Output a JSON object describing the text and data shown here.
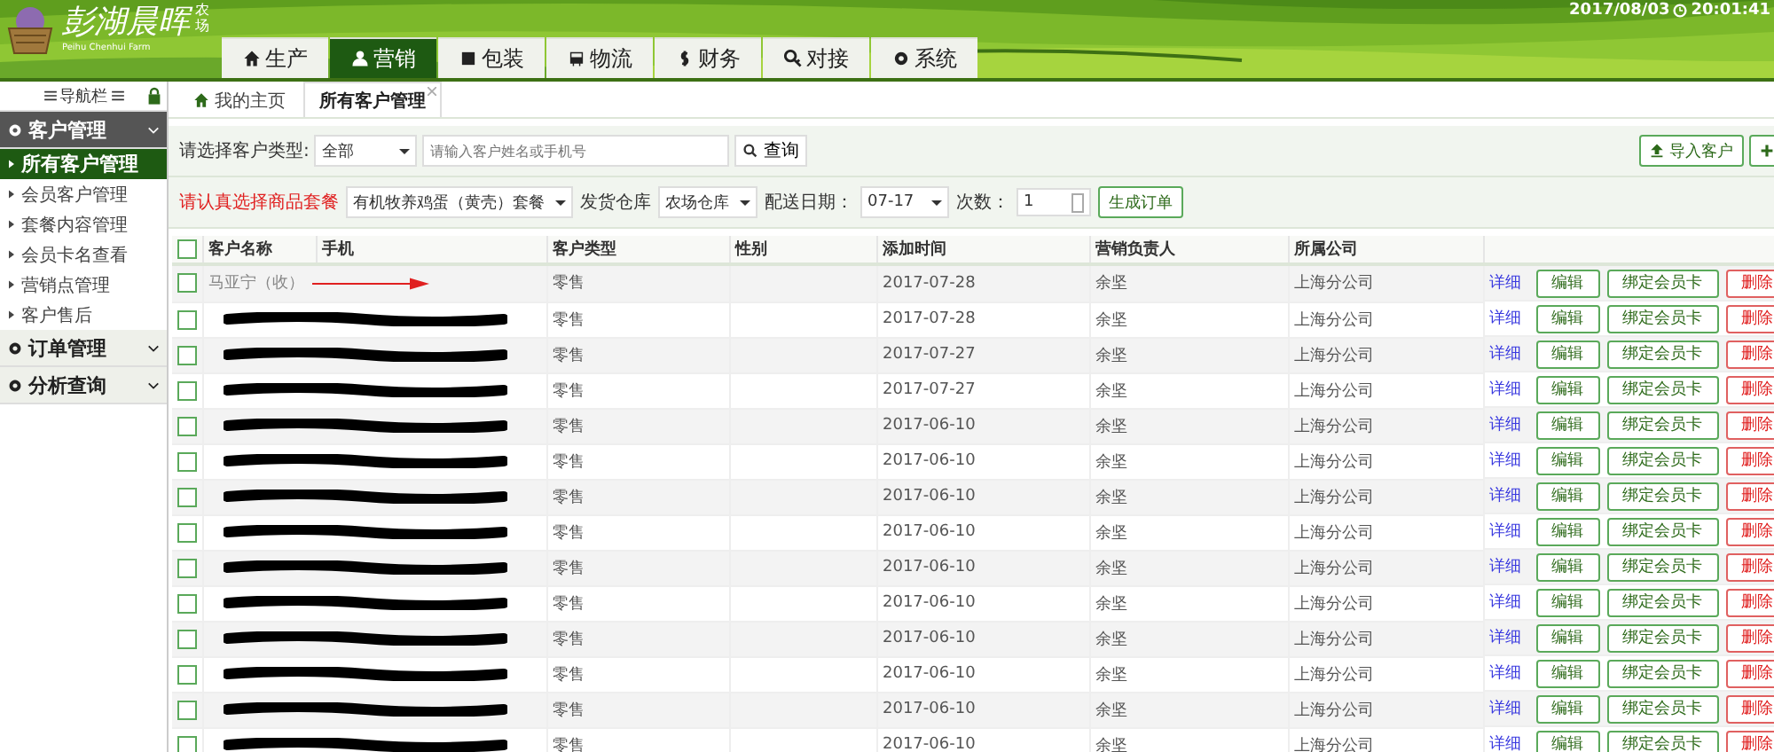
{
  "header": {
    "logo_text": "彭湖晨晖",
    "logo_side": "农场",
    "logo_sub": "Peihu Chenhui Farm",
    "datetime": "2017/08/03",
    "time": "20:01:41"
  },
  "nav_tabs": [
    {
      "label": "生产",
      "selected": false
    },
    {
      "label": "营销",
      "selected": true
    },
    {
      "label": "包装",
      "selected": false
    },
    {
      "label": "物流",
      "selected": false
    },
    {
      "label": "财务",
      "selected": false
    },
    {
      "label": "对接",
      "selected": false
    },
    {
      "label": "系统",
      "selected": false
    }
  ],
  "sidebar": {
    "title": "导航栏",
    "groups": [
      {
        "label": "客户管理",
        "expanded": true,
        "items": [
          {
            "label": "所有客户管理",
            "selected": true
          },
          {
            "label": "会员客户管理",
            "selected": false
          },
          {
            "label": "套餐内容管理",
            "selected": false
          },
          {
            "label": "会员卡名查看",
            "selected": false
          },
          {
            "label": "营销点管理",
            "selected": false
          },
          {
            "label": "客户售后",
            "selected": false
          }
        ]
      },
      {
        "label": "订单管理",
        "expanded": false
      },
      {
        "label": "分析查询",
        "expanded": false
      }
    ]
  },
  "page_tabs": [
    {
      "label": "我的主页",
      "selected": false
    },
    {
      "label": "所有客户管理",
      "selected": true
    }
  ],
  "filter": {
    "type_label": "请选择客户类型:",
    "type_value": "全部",
    "search_placeholder": "请输入客户姓名或手机号",
    "search_button": "查询",
    "import_button": "导入客户"
  },
  "order_bar": {
    "package_label": "请认真选择商品套餐",
    "package_value": "有机牧养鸡蛋（黄壳）套餐",
    "warehouse_label": "发货仓库",
    "warehouse_value": "农场仓库",
    "date_label": "配送日期：",
    "date_value": "07-17",
    "count_label": "次数：",
    "count_value": "1",
    "generate_button": "生成订单"
  },
  "table": {
    "all_checked": false,
    "columns": [
      "客户名称",
      "手机",
      "客户类型",
      "性别",
      "添加时间",
      "营销负责人",
      "所属公司"
    ],
    "rows": [
      {
        "kind": "arrow",
        "name": "马亚宁（收）",
        "type": "零售",
        "added": "2017-07-28",
        "manager": "余坚",
        "company": "上海分公司",
        "checked": false,
        "actions": [
          "详细",
          "编辑",
          "绑定会员卡",
          "删除"
        ]
      },
      {
        "kind": "redacted",
        "type": "零售",
        "added": "2017-07-28",
        "manager": "余坚",
        "company": "上海分公司",
        "checked": false,
        "actions": [
          "详细",
          "编辑",
          "绑定会员卡",
          "删除"
        ]
      },
      {
        "kind": "redacted",
        "type": "零售",
        "added": "2017-07-27",
        "manager": "余坚",
        "company": "上海分公司",
        "checked": false,
        "actions": [
          "详细",
          "编辑",
          "绑定会员卡",
          "删除"
        ]
      },
      {
        "kind": "redacted",
        "type": "零售",
        "added": "2017-07-27",
        "manager": "余坚",
        "company": "上海分公司",
        "checked": false,
        "actions": [
          "详细",
          "编辑",
          "绑定会员卡",
          "删除"
        ]
      },
      {
        "kind": "redacted",
        "type": "零售",
        "added": "2017-06-10",
        "manager": "余坚",
        "company": "上海分公司",
        "checked": false,
        "actions": [
          "详细",
          "编辑",
          "绑定会员卡",
          "删除"
        ]
      },
      {
        "kind": "redacted",
        "type": "零售",
        "added": "2017-06-10",
        "manager": "余坚",
        "company": "上海分公司",
        "checked": false,
        "actions": [
          "详细",
          "编辑",
          "绑定会员卡",
          "删除"
        ]
      },
      {
        "kind": "redacted",
        "type": "零售",
        "added": "2017-06-10",
        "manager": "余坚",
        "company": "上海分公司",
        "checked": false,
        "actions": [
          "详细",
          "编辑",
          "绑定会员卡",
          "删除"
        ]
      },
      {
        "kind": "redacted",
        "type": "零售",
        "added": "2017-06-10",
        "manager": "余坚",
        "company": "上海分公司",
        "checked": false,
        "actions": [
          "详细",
          "编辑",
          "绑定会员卡",
          "删除"
        ]
      },
      {
        "kind": "redacted",
        "type": "零售",
        "added": "2017-06-10",
        "manager": "余坚",
        "company": "上海分公司",
        "checked": false,
        "actions": [
          "详细",
          "编辑",
          "绑定会员卡",
          "删除"
        ]
      },
      {
        "kind": "redacted",
        "type": "零售",
        "added": "2017-06-10",
        "manager": "余坚",
        "company": "上海分公司",
        "checked": false,
        "actions": [
          "详细",
          "编辑",
          "绑定会员卡",
          "删除"
        ]
      },
      {
        "kind": "redacted",
        "type": "零售",
        "added": "2017-06-10",
        "manager": "余坚",
        "company": "上海分公司",
        "checked": false,
        "actions": [
          "详细",
          "编辑",
          "绑定会员卡",
          "删除"
        ]
      },
      {
        "kind": "redacted",
        "type": "零售",
        "added": "2017-06-10",
        "manager": "余坚",
        "company": "上海分公司",
        "checked": false,
        "actions": [
          "详细",
          "编辑",
          "绑定会员卡",
          "删除"
        ]
      },
      {
        "kind": "redacted",
        "type": "零售",
        "added": "2017-06-10",
        "manager": "余坚",
        "company": "上海分公司",
        "checked": false,
        "actions": [
          "详细",
          "编辑",
          "绑定会员卡",
          "删除"
        ]
      },
      {
        "kind": "redacted",
        "type": "零售",
        "added": "2017-06-10",
        "manager": "余坚",
        "company": "上海分公司",
        "checked": false,
        "actions": [
          "详细",
          "编辑",
          "绑定会员卡",
          "删除"
        ]
      }
    ]
  }
}
